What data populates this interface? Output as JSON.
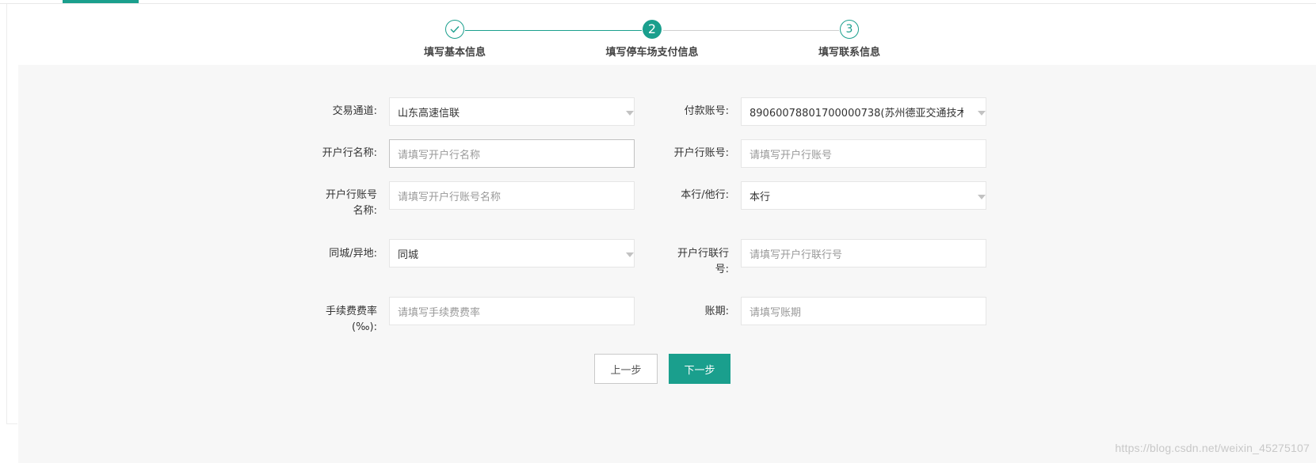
{
  "steps": [
    {
      "label": "填写基本信息",
      "number": "",
      "status": "done"
    },
    {
      "label": "填写停车场支付信息",
      "number": "2",
      "status": "active"
    },
    {
      "label": "填写联系信息",
      "number": "3",
      "status": "wait"
    }
  ],
  "form": {
    "trade_channel": {
      "label": "交易通道:",
      "value": "山东高速信联"
    },
    "pay_account": {
      "label": "付款账号:",
      "value": "8906007880170000073​8(苏州德亚交通技术"
    },
    "bank_name": {
      "label": "开户行名称:",
      "placeholder": "请填写开户行名称"
    },
    "bank_account": {
      "label": "开户行账号:",
      "placeholder": "请填写开户行账号"
    },
    "bank_account_name": {
      "label_line1": "开户行账号",
      "label_line2": "名称:",
      "placeholder": "请填写开户行账号名称"
    },
    "same_bank": {
      "label": "本行/他行:",
      "value": "本行"
    },
    "same_city": {
      "label": "同城/异地:",
      "value": "同城"
    },
    "bank_union_no": {
      "label_line1": "开户行联行",
      "label_line2": "号:",
      "placeholder": "请填写开户行联行号"
    },
    "fee_rate": {
      "label_line1": "手续费费率",
      "label_line2": "(‰):",
      "placeholder": "请填写手续费费率"
    },
    "account_period": {
      "label": "账期:",
      "placeholder": "请填写账期"
    }
  },
  "buttons": {
    "prev": "上一步",
    "next": "下一步"
  },
  "watermark": "https://blog.csdn.net/weixin_45275107",
  "colors": {
    "accent": "#1a9f8d",
    "panel_bg": "#f7f7f7"
  }
}
